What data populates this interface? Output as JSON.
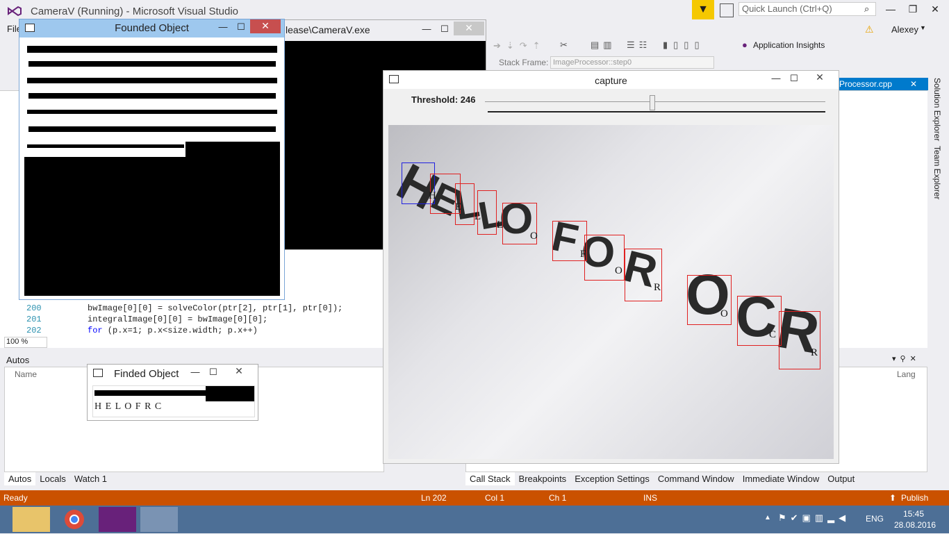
{
  "vs": {
    "title": "CameraV (Running) - Microsoft Visual Studio",
    "quick_launch_placeholder": "Quick Launch (Ctrl+Q)",
    "user": "Alexey",
    "menu_file": "File",
    "app_insights": "Application Insights",
    "stack_frame_label": "Stack Frame:",
    "stack_frame_value": "ImageProcessor::step0",
    "file_tab": "Processor.cpp",
    "zoom": "100 %",
    "side_tabs": [
      "Solution Explorer",
      "Team Explorer"
    ]
  },
  "console": {
    "title": "lease\\CameraV.exe"
  },
  "code_lines": [
    {
      "num": "200",
      "text": "bwImage[0][0] = solveColor(ptr[2], ptr[1], ptr[0]);"
    },
    {
      "num": "201",
      "text": "integralImage[0][0] = bwImage[0][0];"
    },
    {
      "num": "202",
      "kw": "for",
      "text": " (p.x=1; p.x<size.width; p.x++)"
    }
  ],
  "founded": {
    "title": "Founded Object"
  },
  "finded": {
    "title": "Finded Object",
    "result_text": "H E L O F R C"
  },
  "capture": {
    "title": "capture",
    "threshold_label": "Threshold: 246",
    "threshold_fraction": 0.49,
    "letters": [
      "H",
      "E",
      "L",
      "L",
      "O",
      "F",
      "O",
      "R",
      "O",
      "C",
      "R"
    ],
    "detections": [
      "H",
      "E",
      "L",
      "L",
      "O",
      "F",
      "O",
      "R",
      "O",
      "C",
      "R"
    ]
  },
  "autos": {
    "header": "Autos",
    "col_name": "Name",
    "col_lang": "Lang",
    "tabs": [
      "Autos",
      "Locals",
      "Watch 1"
    ]
  },
  "debug_tabs": [
    "Call Stack",
    "Breakpoints",
    "Exception Settings",
    "Command Window",
    "Immediate Window",
    "Output"
  ],
  "status": {
    "ready": "Ready",
    "ln": "Ln 202",
    "col": "Col 1",
    "ch": "Ch 1",
    "ins": "INS",
    "publish": "Publish"
  },
  "taskbar": {
    "lang": "ENG",
    "time": "15:45",
    "date": "28.08.2016"
  }
}
